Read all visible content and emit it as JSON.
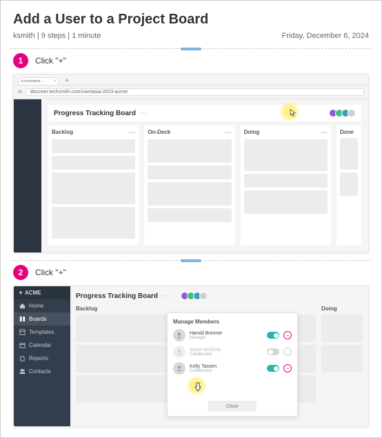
{
  "title": "Add a User to a Project Board",
  "meta": {
    "author": "ksmith",
    "steps": "9 steps",
    "duration": "1 minute",
    "date": "Friday, December 6, 2024"
  },
  "step1": {
    "num": "1",
    "label": "Click \"+\"",
    "browser": {
      "tab_label": "h.com/camts…",
      "url": "discover.techsmith.com/camtasia-2023-acme/"
    },
    "board_title": "Progress Tracking Board",
    "columns": [
      "Backlog",
      "On-Deck",
      "Doing",
      "Done"
    ]
  },
  "step2": {
    "num": "2",
    "label": "Click \"+\"",
    "brand": "ACME",
    "nav": [
      {
        "icon": "home",
        "label": "Home"
      },
      {
        "icon": "boards",
        "label": "Boards"
      },
      {
        "icon": "templates",
        "label": "Templates"
      },
      {
        "icon": "calendar",
        "label": "Calendar"
      },
      {
        "icon": "reports",
        "label": "Reports"
      },
      {
        "icon": "contacts",
        "label": "Contacts"
      }
    ],
    "board_title": "Progress Tracking Board",
    "columns": [
      "Backlog",
      "Doing"
    ],
    "popover": {
      "title": "Manage Members",
      "members": [
        {
          "name": "Harold Brenner",
          "role": "Manager",
          "on": true,
          "active": true
        },
        {
          "name": "Steve McGinty",
          "role": "Collaborator",
          "on": false,
          "active": false
        },
        {
          "name": "Kelly Tassen",
          "role": "Collaborator",
          "on": true,
          "active": true
        }
      ],
      "close": "Close"
    }
  }
}
